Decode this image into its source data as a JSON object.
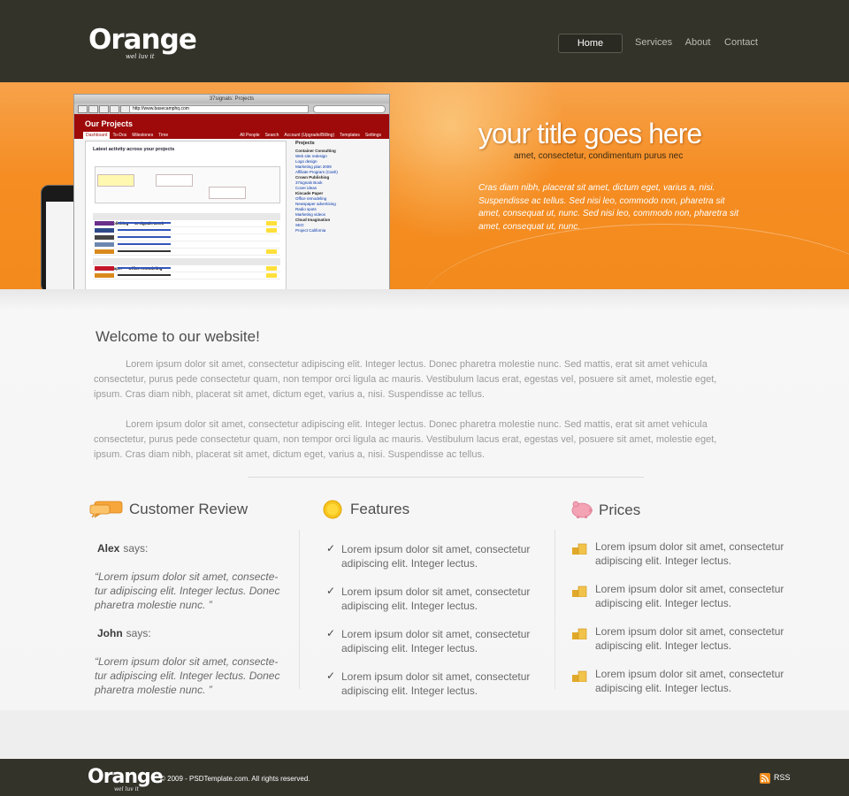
{
  "header": {
    "logo": "Orange",
    "tagline": "wel luv it",
    "nav": [
      "Home",
      "Services",
      "About",
      "Contact"
    ]
  },
  "banner": {
    "title": "your title goes here",
    "subtitle": "amet, consectetur,      condimentum purus nec",
    "text": "Cras diam nibh, placerat sit amet, dictum eget, varius a, nisi. Suspendisse ac tellus. Sed nisi leo, commodo non, pharetra sit amet, consequat ut, nunc. Sed nisi leo, commodo non, pharetra sit amet, consequat ut, nunc.",
    "screenshot": {
      "window_title": "37signals: Projects",
      "url": "http://www.basecamphq.com",
      "app_title": "Our Projects",
      "tabs": [
        "Dashboard",
        "To-Dos",
        "Milestones",
        "Time"
      ],
      "right_tabs": [
        "All People",
        "Search",
        "Account (Upgrade/Billing)",
        "Templates",
        "Settings"
      ],
      "activity_title": "Latest activity across your projects",
      "sidebar_title": "Projects",
      "sidebar": [
        "Container Consulting",
        "Web site redesign",
        "Logo design",
        "Marketing plan 2009",
        "Affiliate Program (Cash)",
        "Crown Publishing",
        "37signals Book",
        "Cover ideas",
        "Kincade Paper",
        "Office remodeling",
        "Newspaper advertising",
        "Radio spots",
        "Marketing videos",
        "Cloud Imagination",
        "SEO",
        "Project California"
      ],
      "sections": [
        "Crown Publishing — 37signals Book",
        "Kincade Paper — Office remodeling"
      ]
    }
  },
  "main": {
    "welcome": "Welcome to our website!",
    "intro": [
      "Lorem ipsum dolor sit amet, consectetur adipiscing elit. Integer lectus. Donec pharetra molestie nunc. Sed mattis, erat sit amet vehicula consectetur, purus pede consectetur quam, non tempor orci ligula ac mauris. Vestibulum lacus erat, egestas vel, posuere sit amet, molestie eget, ipsum. Cras diam nibh, placerat sit amet, dictum eget, varius a, nisi. Suspendisse ac tellus.",
      "Lorem ipsum dolor sit amet, consectetur adipiscing elit. Integer lectus. Donec pharetra molestie nunc. Sed mattis, erat sit amet vehicula consectetur, purus pede consectetur quam, non tempor orci ligula ac mauris. Vestibulum lacus erat, egestas vel, posuere sit amet, molestie eget, ipsum. Cras diam nibh, placerat sit amet, dictum eget, varius a, nisi. Suspendisse ac tellus."
    ]
  },
  "review": {
    "title": "Customer Review",
    "says": "says:",
    "items": [
      {
        "name": "Alex",
        "quote": "“Lorem ipsum dolor sit amet, consecte-tur adipiscing elit. Integer lectus. Donec pharetra molestie nunc. ”"
      },
      {
        "name": "John",
        "quote": "“Lorem ipsum dolor sit amet, consecte-tur adipiscing elit. Integer lectus. Donec pharetra molestie nunc. ”"
      }
    ]
  },
  "features": {
    "title": "Features",
    "items": [
      "Lorem ipsum dolor sit amet, consectetur adipiscing elit. Integer lectus.",
      "Lorem ipsum dolor sit amet, consectetur adipiscing elit. Integer lectus.",
      "Lorem ipsum dolor sit amet, consectetur adipiscing elit. Integer lectus.",
      "Lorem ipsum dolor sit amet, consectetur adipiscing elit. Integer lectus."
    ]
  },
  "prices": {
    "title": "Prices",
    "items": [
      "Lorem ipsum dolor sit amet, consectetur adipiscing elit. Integer lectus.",
      "Lorem ipsum dolor sit amet, consectetur adipiscing elit. Integer lectus.",
      "Lorem ipsum dolor sit amet, consectetur adipiscing elit. Integer lectus.",
      "Lorem ipsum dolor sit amet, consectetur adipiscing elit. Integer lectus."
    ]
  },
  "footer": {
    "logo": "Orange",
    "tagline": "wel luv it",
    "copyright": "© 2009 - PSDTemplate.com. All rights reserved.",
    "rss": "RSS"
  },
  "colors": {
    "header_bg": "#33332a",
    "accent_orange": "#f58d23",
    "text_gray": "#6a6a6a"
  },
  "icons": [
    "speech-bubble-icon",
    "sun-icon",
    "piggy-bank-icon",
    "check-icon",
    "coins-icon",
    "rss-icon"
  ]
}
